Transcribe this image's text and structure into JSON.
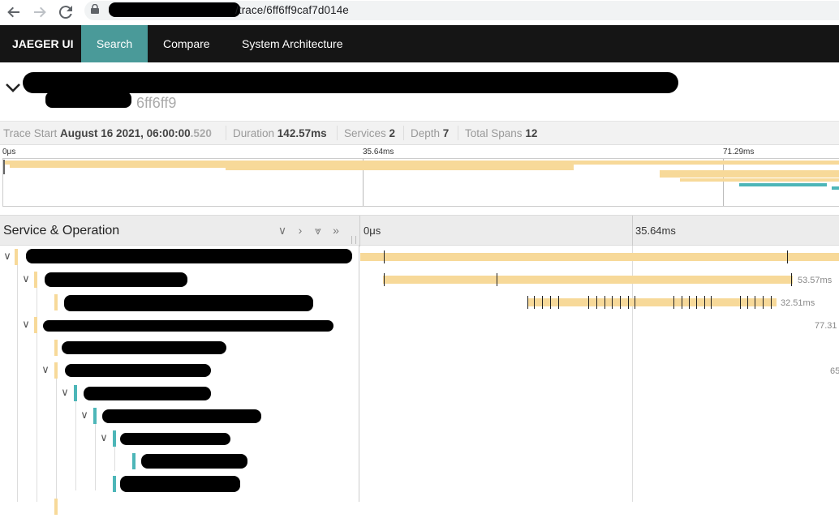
{
  "browser": {
    "back_icon": "arrow-left-icon",
    "forward_icon": "arrow-right-icon",
    "reload_icon": "reload-icon",
    "url_suffix": "/trace/6ff6ff9caf7d014e"
  },
  "topnav": {
    "brand": "JAEGER UI",
    "items": [
      "Search",
      "Compare",
      "System Architecture"
    ],
    "active": "Search"
  },
  "trace": {
    "title_suffix": "6ff6ff9",
    "meta": {
      "trace_start_label": "Trace Start",
      "trace_start_value": "August 16 2021, 06:00:00",
      "trace_start_ms": ".520",
      "duration_label": "Duration",
      "duration_value": "142.57ms",
      "services_label": "Services",
      "services_value": "2",
      "depth_label": "Depth",
      "depth_value": "7",
      "total_spans_label": "Total Spans",
      "total_spans_value": "12"
    }
  },
  "minimap": {
    "ticks": [
      "0μs",
      "35.64ms",
      "71.29ms"
    ]
  },
  "timeline_header": {
    "label": "Service & Operation",
    "ticks": [
      "0μs",
      "35.64ms"
    ]
  },
  "spans": [
    {
      "duration": ""
    },
    {
      "duration": "53.57ms"
    },
    {
      "duration": "32.51ms"
    },
    {
      "duration": "77.31"
    },
    {
      "duration": ""
    },
    {
      "duration": "65"
    },
    {
      "duration": ""
    },
    {
      "duration": ""
    },
    {
      "duration": ""
    },
    {
      "duration": ""
    },
    {
      "duration": ""
    }
  ],
  "colors": {
    "nav_bg": "#151515",
    "nav_active": "#4a9a99",
    "span_service_a": "#f7d999",
    "span_service_b": "#4db6b8"
  }
}
